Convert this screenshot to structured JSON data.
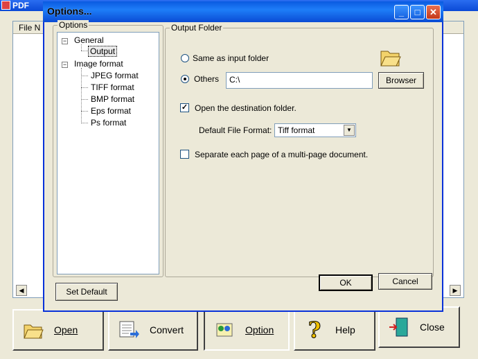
{
  "main": {
    "title": "PDF",
    "list_header": "File N",
    "buttons": {
      "open": "Open",
      "convert": "Convert",
      "option": "Option",
      "help": "Help",
      "close": "Close"
    },
    "open_mnemonic": "O",
    "help_mnemonic": "H"
  },
  "dialog": {
    "title": "Options...",
    "tree_group_label": "Options",
    "tree": {
      "general": "General",
      "output": "Output",
      "image_format": "Image format",
      "formats": [
        "JPEG format",
        "TIFF format",
        "BMP format",
        "Eps format",
        "Ps format"
      ]
    },
    "output_group_label": "Output Folder",
    "same_as_input": "Same as input folder",
    "others": "Others",
    "others_path": "C:\\",
    "browser_button": "Browser",
    "open_destination": "Open the destination folder.",
    "default_format_label": "Default File Format:",
    "default_format_value": "Tiff format",
    "separate_pages": "Separate each page of a multi-page document.",
    "set_default": "Set Default",
    "ok": "OK",
    "cancel": "Cancel",
    "selected_radio": "others",
    "open_destination_checked": true,
    "separate_pages_checked": false
  },
  "colors": {
    "titlebar": "#0a5ae0",
    "dialog_face": "#ece9d8",
    "close_button": "#c4381a"
  }
}
